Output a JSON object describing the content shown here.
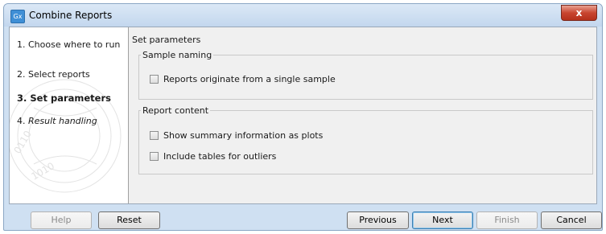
{
  "window": {
    "title": "Combine Reports",
    "app_icon_text": "Gx",
    "close_glyph": "x",
    "close_color": "#c8452f"
  },
  "sidebar": {
    "steps": [
      {
        "number": "1.",
        "label": "Choose where to run",
        "state": "normal"
      },
      {
        "number": "2.",
        "label": "Select reports",
        "state": "normal"
      },
      {
        "number": "3.",
        "label": "Set parameters",
        "state": "active"
      },
      {
        "number": "4.",
        "label": "Result handling",
        "state": "italic"
      }
    ]
  },
  "main": {
    "heading": "Set parameters",
    "groups": [
      {
        "legend": "Sample naming",
        "options": [
          {
            "label": "Reports originate from a single sample",
            "checked": false
          }
        ]
      },
      {
        "legend": "Report content",
        "options": [
          {
            "label": "Show summary information as plots",
            "checked": false
          },
          {
            "label": "Include tables for outliers",
            "checked": false
          }
        ]
      }
    ]
  },
  "footer": {
    "help": "Help",
    "reset": "Reset",
    "previous": "Previous",
    "next": "Next",
    "finish": "Finish",
    "cancel": "Cancel"
  }
}
